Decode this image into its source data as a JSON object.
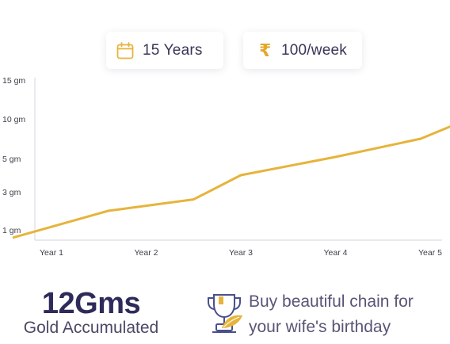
{
  "plan": {
    "duration_label": "15 Years",
    "duration_icon": "calendar-icon",
    "amount_symbol": "₹",
    "amount_label": "100/week",
    "accent_color": "#e6b43c"
  },
  "chart_data": {
    "type": "line",
    "title": "",
    "xlabel": "",
    "ylabel": "",
    "categories": [
      "Year 1",
      "Year 2",
      "Year 3",
      "Year 4",
      "Year 5"
    ],
    "y_tick_labels": [
      "1 gm",
      "3 gm",
      "5 gm",
      "10 gm",
      "15 gm"
    ],
    "y_tick_values": [
      1,
      3,
      5,
      10,
      15
    ],
    "y_scale": "non-linear (ticks evenly spaced: 1, 3, 5, 10, 15 gm)",
    "series": [
      {
        "x": [
          0.6,
          1.6,
          2.5,
          3.0,
          4.0,
          4.9,
          5.8
        ],
        "y": [
          0.6,
          2.0,
          2.6,
          4.0,
          5.2,
          7.5,
          12.0
        ]
      }
    ],
    "ylim": [
      0.6,
      15
    ],
    "grid": false,
    "legend": "none",
    "line_color": "#e6b43c"
  },
  "summary": {
    "value": "12Gms",
    "caption": "Gold Accumulated"
  },
  "promo": {
    "icon": "trophy-icon",
    "text_line1": "Buy beautiful chain for",
    "text_line2": "your wife's birthday"
  }
}
